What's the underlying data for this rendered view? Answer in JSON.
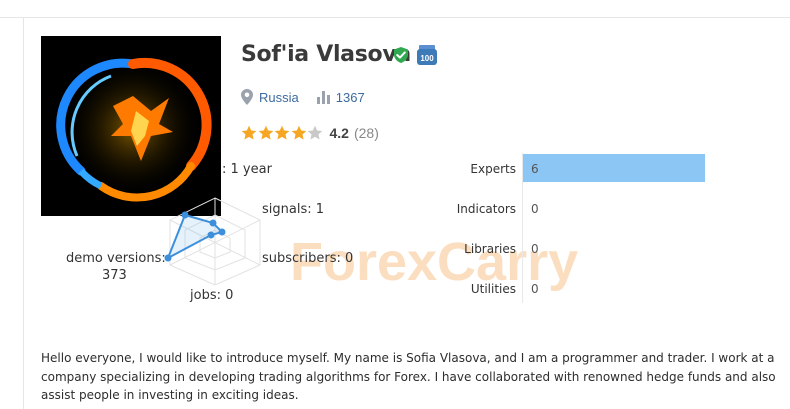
{
  "profile": {
    "name": "Sof'ia Vlasova",
    "country": "Russia",
    "rating": "1367",
    "stars": 4,
    "score": "4.2",
    "reviews": "(28)",
    "badge_icon": "medal-100-icon",
    "verified_icon": "verified-shield-icon"
  },
  "stats": {
    "experience": ": 1 year",
    "signals": "signals: 1",
    "demo_label": "demo versions:",
    "demo_value": "373",
    "subscribers": "subscribers: 0",
    "jobs": "jobs: 0"
  },
  "products": [
    {
      "label": "Experts",
      "value": "6",
      "fill": 1.0
    },
    {
      "label": "Indicators",
      "value": "0",
      "fill": 0
    },
    {
      "label": "Libraries",
      "value": "0",
      "fill": 0
    },
    {
      "label": "Utilities",
      "value": "0",
      "fill": 0
    }
  ],
  "watermark": "ForexCarry",
  "bio": "Hello everyone, I would like to introduce myself. My name is Sofia Vlasova, and I am a programmer and trader. I work at a company specializing in developing trading algorithms for Forex. I have collaborated with renowned hedge funds and also assist people in investing in exciting ideas.",
  "colors": {
    "accent": "#3d6a9e",
    "bar": "#8cc6f4",
    "star": "#f5a623",
    "verified": "#2fa84f",
    "badge": "#3d7ab8"
  }
}
